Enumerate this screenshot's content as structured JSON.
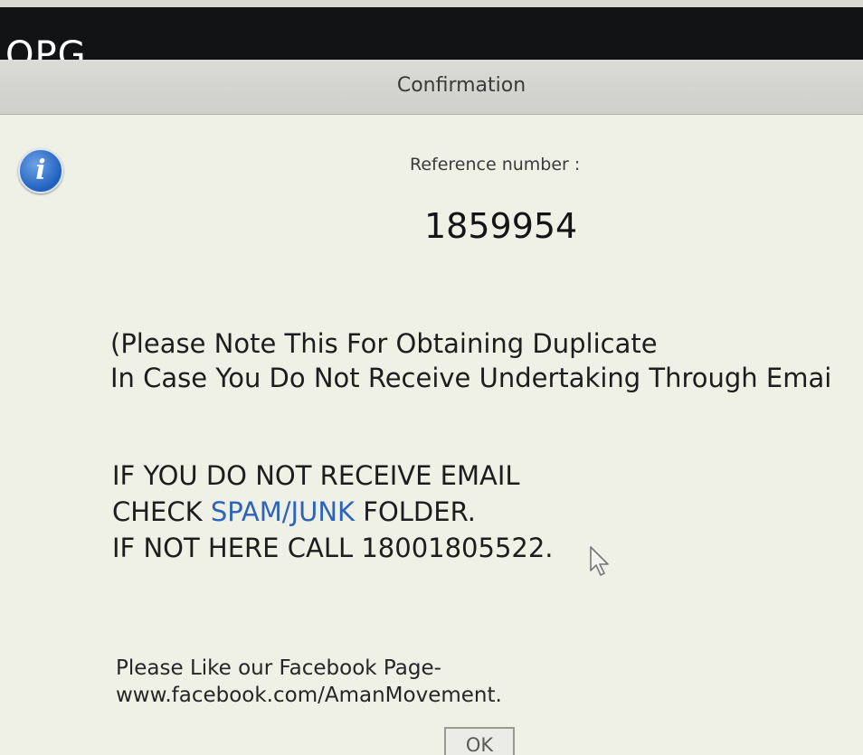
{
  "app": {
    "logo_text": "OPG"
  },
  "dialog": {
    "title": "Confirmation",
    "reference_label": "Reference number :",
    "reference_number": "1859954",
    "note_line_1": "(Please Note This For Obtaining Duplicate",
    "note_line_2": "In Case You Do Not Receive Undertaking Through Emai",
    "warning_line_1": "IF YOU DO NOT RECEIVE EMAIL",
    "warning_line_2_prefix": "CHECK ",
    "warning_line_2_link": "SPAM/JUNK",
    "warning_line_2_suffix": " FOLDER.",
    "warning_line_3": "IF NOT HERE CALL 18001805522.",
    "facebook_line_1": "Please Like our Facebook Page-",
    "facebook_line_2": "www.facebook.com/AmanMovement.",
    "ok_button_label": "OK",
    "icon": "info-icon"
  },
  "colors": {
    "app_bar": "#111314",
    "dialog_bg": "#eff0e6",
    "link_blue": "#2d64b8",
    "info_icon_blue": "#1f5fbf"
  }
}
